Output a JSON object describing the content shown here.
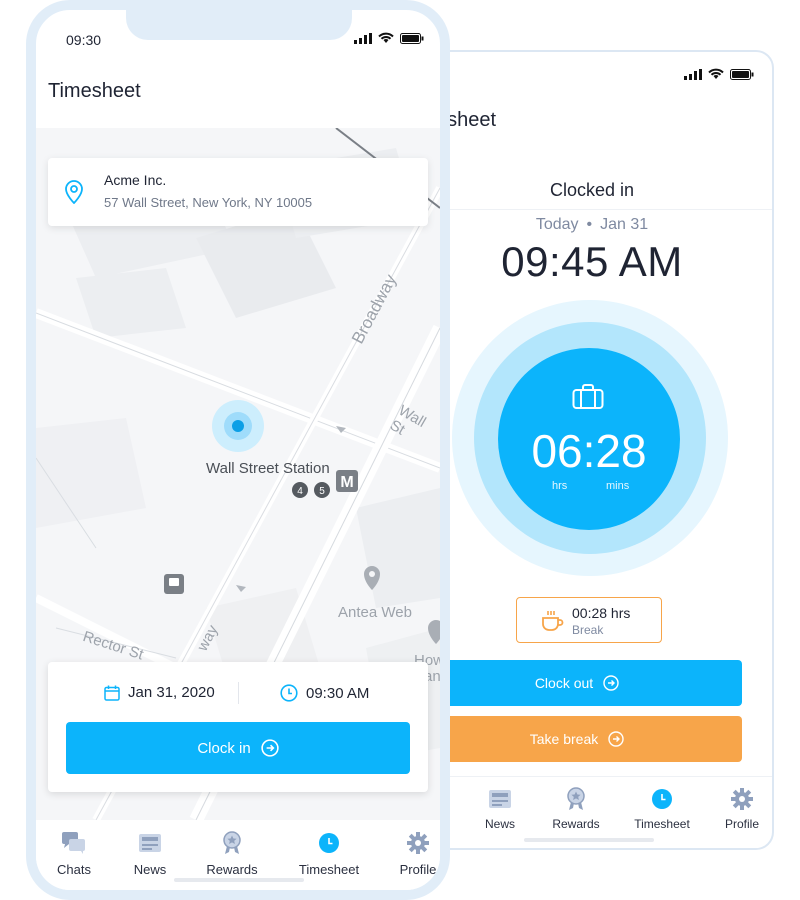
{
  "front": {
    "status_time": "09:30",
    "title": "Timesheet",
    "location": {
      "name": "Acme Inc.",
      "address": "57 Wall Street, New York, NY 10005"
    },
    "map_labels": {
      "station": "Wall Street Station",
      "broadway": "Broadway",
      "wall_st": "Wall St",
      "antea": "Antea Web",
      "rector": "Rector St",
      "way": "way",
      "how": "How",
      "an": "an",
      "line_4": "4",
      "line_5": "5",
      "metro": "M"
    },
    "clockin": {
      "date": "Jan 31, 2020",
      "time": "09:30 AM",
      "button_label": "Clock in"
    },
    "nav": [
      {
        "label": "Chats",
        "icon": "chat-icon"
      },
      {
        "label": "News",
        "icon": "news-icon"
      },
      {
        "label": "Rewards",
        "icon": "rewards-icon"
      },
      {
        "label": "Timesheet",
        "icon": "clock-icon"
      },
      {
        "label": "Profile",
        "icon": "gear-icon"
      }
    ]
  },
  "back": {
    "title_partial": "esheet",
    "status": "Clocked in",
    "date_prefix": "Today",
    "date_dot": "•",
    "date": "Jan 31",
    "clock_time": "09:45 AM",
    "timer": {
      "value": "06:28",
      "hrs_label": "hrs",
      "mins_label": "mins"
    },
    "break": {
      "value": "00:28 hrs",
      "label": "Break"
    },
    "clockout_label": "Clock out",
    "take_break_label": "Take break",
    "nav": [
      {
        "label": "News",
        "icon": "news-icon"
      },
      {
        "label": "Rewards",
        "icon": "rewards-icon"
      },
      {
        "label": "Timesheet",
        "icon": "clock-icon"
      },
      {
        "label": "Profile",
        "icon": "gear-icon"
      }
    ]
  },
  "colors": {
    "primary": "#0cb4fb",
    "accent": "#f7a54a",
    "text": "#1f2433",
    "muted": "#7f8aa1"
  }
}
